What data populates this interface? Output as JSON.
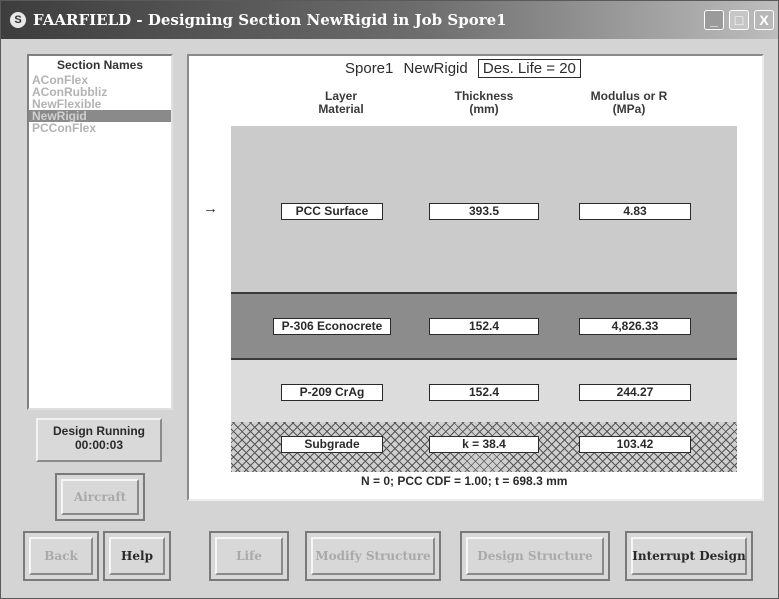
{
  "window": {
    "title": "FAARFIELD - Designing Section NewRigid in Job Spore1",
    "icons": {
      "app": "faa-logo-icon",
      "min": "minimize-icon",
      "max": "maximize-icon",
      "close": "close-icon"
    },
    "min_glyph": "_",
    "max_glyph": "□",
    "close_glyph": "X"
  },
  "sections": {
    "header": "Section Names",
    "items": [
      "AConFlex",
      "AConRubbliz",
      "NewFlexible",
      "NewRigid",
      "PCConFlex"
    ],
    "selected": "NewRigid"
  },
  "status": {
    "label": "Design Running",
    "time": "00:00:03"
  },
  "design": {
    "job": "Spore1",
    "section": "NewRigid",
    "des_life": "Des. Life = 20",
    "col_material": "Layer\nMaterial",
    "col_material_l1": "Layer",
    "col_material_l2": "Material",
    "col_thickness_l1": "Thickness",
    "col_thickness_l2": "(mm)",
    "col_modulus_l1": "Modulus or R",
    "col_modulus_l2": "(MPa)",
    "arrow": "→",
    "layers": [
      {
        "material": "PCC Surface",
        "thickness": "393.5",
        "modulus": "4.83"
      },
      {
        "material": "P-306 Econocrete",
        "thickness": "152.4",
        "modulus": "4,826.33"
      },
      {
        "material": "P-209 CrAg",
        "thickness": "152.4",
        "modulus": "244.27"
      },
      {
        "material": "Subgrade",
        "thickness": "k = 38.4",
        "modulus": "103.42"
      }
    ],
    "footer": "N = 0; PCC CDF = 1.00; t = 698.3 mm"
  },
  "buttons": {
    "aircraft": "Aircraft",
    "back": "Back",
    "help": "Help",
    "life": "Life",
    "modify": "Modify Structure",
    "design": "Design Structure",
    "interrupt": "Interrupt Design"
  },
  "colors": {
    "surface": "#cbcbcb",
    "base": "#8c8c8c",
    "subbase": "#dcdcdc",
    "disabled_text": "#a9a9a9"
  }
}
